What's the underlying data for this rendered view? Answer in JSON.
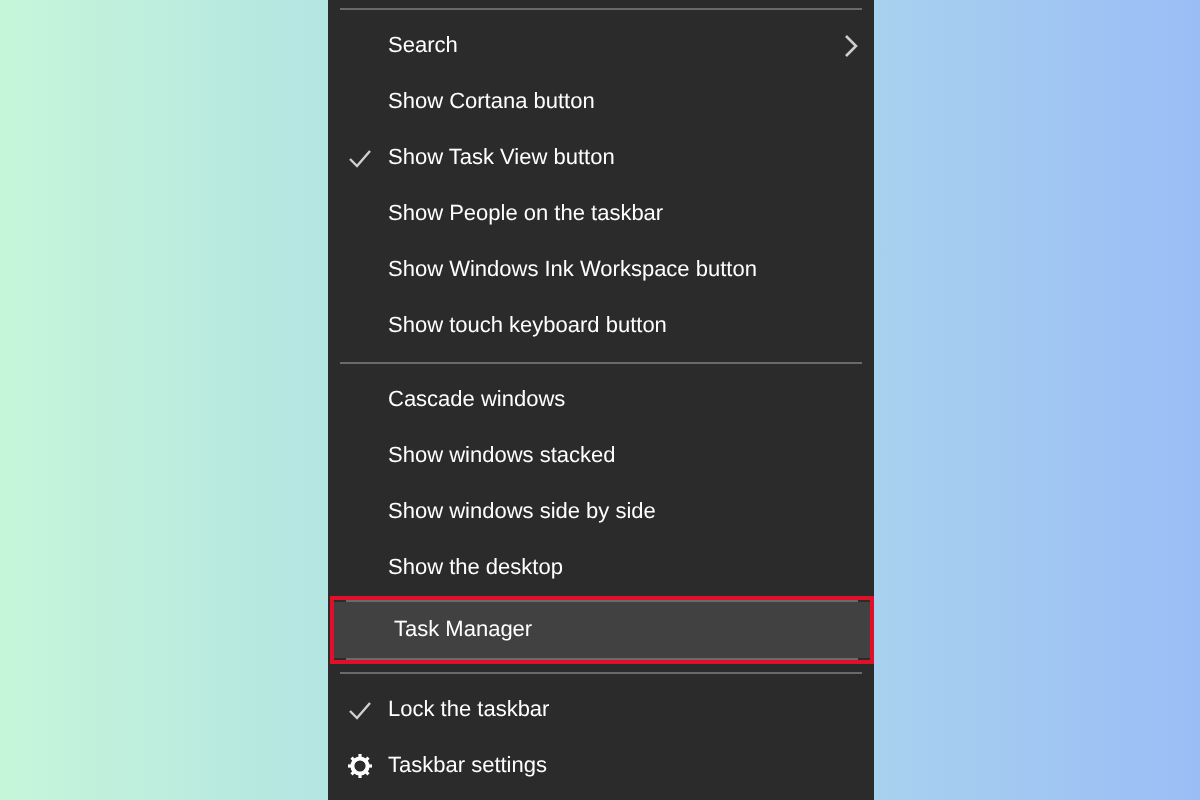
{
  "menu": {
    "sections": [
      {
        "annotated": false,
        "items": [
          {
            "kind": "submenu",
            "label": "Search",
            "checked": false,
            "selected": false
          },
          {
            "kind": "plain",
            "label": "Show Cortana button",
            "checked": false,
            "selected": false
          },
          {
            "kind": "plain",
            "label": "Show Task View button",
            "checked": true,
            "selected": false
          },
          {
            "kind": "plain",
            "label": "Show People on the taskbar",
            "checked": false,
            "selected": false
          },
          {
            "kind": "plain",
            "label": "Show Windows Ink Workspace button",
            "checked": false,
            "selected": false
          },
          {
            "kind": "plain",
            "label": "Show touch keyboard button",
            "checked": false,
            "selected": false
          }
        ]
      },
      {
        "annotated": false,
        "items": [
          {
            "kind": "plain",
            "label": "Cascade windows",
            "checked": false,
            "selected": false
          },
          {
            "kind": "plain",
            "label": "Show windows stacked",
            "checked": false,
            "selected": false
          },
          {
            "kind": "plain",
            "label": "Show windows side by side",
            "checked": false,
            "selected": false
          },
          {
            "kind": "plain",
            "label": "Show the desktop",
            "checked": false,
            "selected": false
          }
        ]
      },
      {
        "annotated": true,
        "items": [
          {
            "kind": "plain",
            "label": "Task Manager",
            "checked": false,
            "selected": true
          }
        ]
      },
      {
        "annotated": false,
        "items": [
          {
            "kind": "plain",
            "label": "Lock the taskbar",
            "checked": true,
            "selected": false
          },
          {
            "kind": "settings",
            "label": "Taskbar settings",
            "checked": false,
            "selected": false
          }
        ]
      }
    ]
  }
}
